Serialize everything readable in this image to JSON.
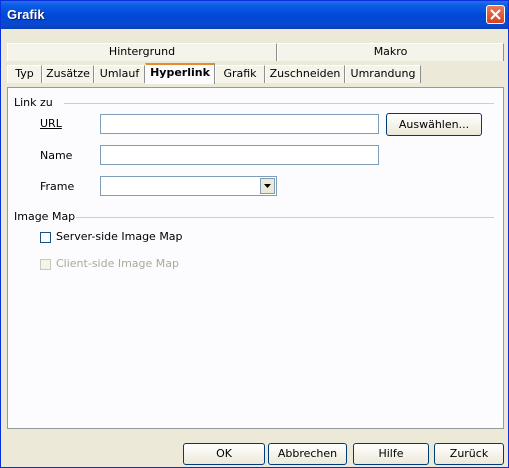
{
  "window": {
    "title": "Grafik"
  },
  "tabs_row1": [
    {
      "label": "Hintergrund"
    },
    {
      "label": "Makro"
    }
  ],
  "tabs_row2": [
    {
      "label": "Typ"
    },
    {
      "label": "Zusätze"
    },
    {
      "label": "Umlauf"
    },
    {
      "label": "Hyperlink",
      "active": true
    },
    {
      "label": "Grafik"
    },
    {
      "label": "Zuschneiden"
    },
    {
      "label": "Umrandung"
    }
  ],
  "link_section": {
    "title": "Link zu",
    "url_label": "URL",
    "url_value": "",
    "browse_button": "Auswählen...",
    "name_label": "Name",
    "name_value": "",
    "frame_label": "Frame",
    "frame_value": ""
  },
  "image_map_section": {
    "title": "Image Map",
    "server_side_label": "Server-side Image Map",
    "server_side_checked": false,
    "client_side_label": "Client-side Image Map",
    "client_side_checked": false,
    "client_side_enabled": false
  },
  "footer": {
    "ok": "OK",
    "cancel": "Abbrechen",
    "help": "Hilfe",
    "reset": "Zurück"
  },
  "colors": {
    "titlebar": "#0047d6",
    "dialog_bg": "#ece9d8",
    "active_tab_accent": "#e68b2c"
  }
}
